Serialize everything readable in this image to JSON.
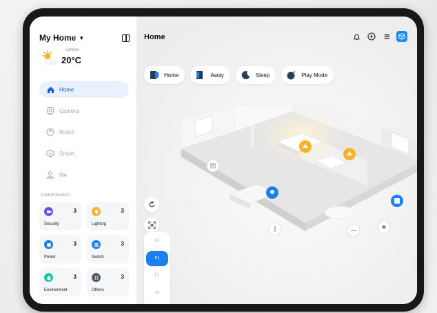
{
  "colors": {
    "accent": "#1d7fee",
    "active_bg": "#e8f1fd",
    "light_marker": "#f7b32b"
  },
  "sidebar": {
    "home_selector": "My Home",
    "weather": {
      "city": "London",
      "temperature": "20°C",
      "icon": "sun-cloud-icon"
    },
    "nav": [
      {
        "label": "Home",
        "icon": "home-icon",
        "active": true
      },
      {
        "label": "Camera",
        "icon": "camera-icon",
        "active": false
      },
      {
        "label": "Robot",
        "icon": "robot-icon",
        "active": false
      },
      {
        "label": "Smart",
        "icon": "smart-icon",
        "active": false
      },
      {
        "label": "Me",
        "icon": "user-icon",
        "active": false
      }
    ],
    "control_system_label": "Control System",
    "control_cards": [
      {
        "name": "Security",
        "count": "3",
        "icon": "security-icon",
        "color": "#6a4ff0"
      },
      {
        "name": "Lighting",
        "count": "3",
        "icon": "bulb-icon",
        "color": "#f7b32b"
      },
      {
        "name": "Power",
        "count": "3",
        "icon": "power-icon",
        "color": "#1d7fee"
      },
      {
        "name": "Switch",
        "count": "3",
        "icon": "switch-icon",
        "color": "#1d7fee"
      },
      {
        "name": "Environment",
        "count": "3",
        "icon": "drop-icon",
        "color": "#1fc4a8"
      },
      {
        "name": "Others",
        "count": "3",
        "icon": "grid-icon",
        "color": "#555a63"
      }
    ]
  },
  "main": {
    "title": "Home",
    "scenes": [
      {
        "label": "Home",
        "icon": "door-in-icon"
      },
      {
        "label": "Away",
        "icon": "door-out-icon"
      },
      {
        "label": "Sleep",
        "icon": "moon-icon"
      },
      {
        "label": "Play Mode",
        "icon": "play-icon"
      }
    ],
    "floors": [
      "F3",
      "F2",
      "F1",
      "All"
    ],
    "active_floor": "F2"
  }
}
